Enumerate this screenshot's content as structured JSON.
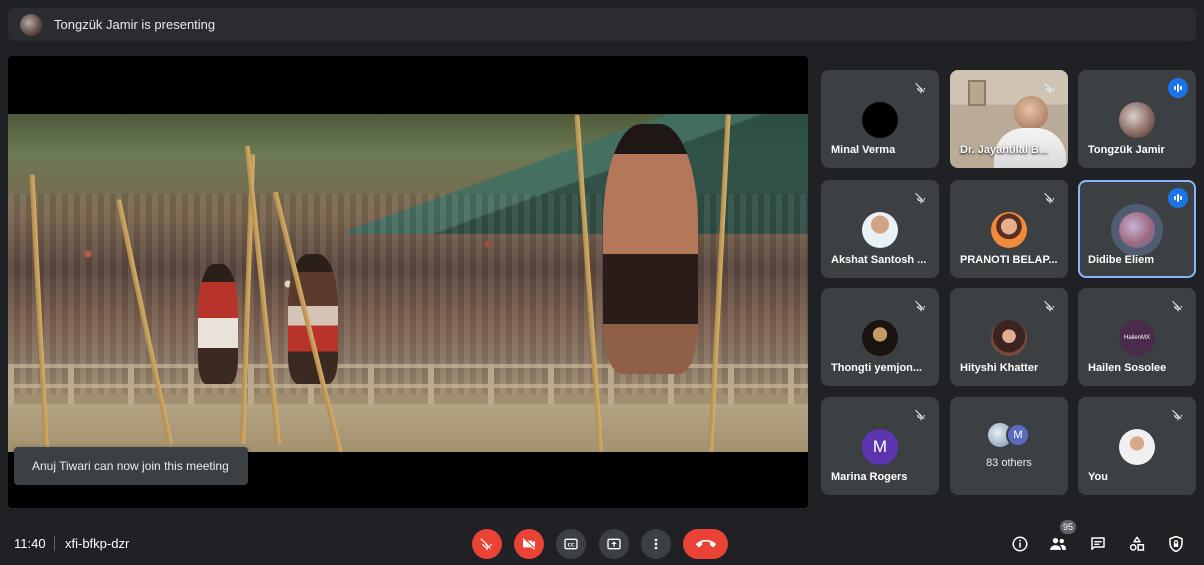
{
  "presenting": {
    "text": "Tongzük Jamir is presenting"
  },
  "toast": {
    "text": "Anuj Tiwari can now join this meeting"
  },
  "participants": [
    {
      "name": "Minal Verma",
      "state": "muted"
    },
    {
      "name": "Dr. Jayantilal B...",
      "state": "muted"
    },
    {
      "name": "Tongzük Jamir",
      "state": "speaking"
    },
    {
      "name": "Akshat Santosh ...",
      "state": "muted"
    },
    {
      "name": "PRANOTI BELAP...",
      "state": "muted"
    },
    {
      "name": "Didibe Eliem",
      "state": "speaking"
    },
    {
      "name": "Thongti yemjon...",
      "state": "muted"
    },
    {
      "name": "Hityshi Khatter",
      "state": "muted"
    },
    {
      "name": "Hailen Sosolee",
      "state": "muted",
      "avatar_text": "HailenMX"
    },
    {
      "name": "Marina Rogers",
      "state": "muted",
      "avatar_letter": "M"
    },
    {
      "name": "83 others",
      "avatar_letter": "M"
    },
    {
      "name": "You",
      "state": "muted"
    }
  ],
  "controls": {
    "time": "11:40",
    "meeting_code": "xfi-bfkp-dzr",
    "people_count": "95"
  },
  "colors": {
    "accent": "#1a73e8",
    "danger": "#ea4335",
    "tile": "#3c4043",
    "background": "#202124"
  }
}
